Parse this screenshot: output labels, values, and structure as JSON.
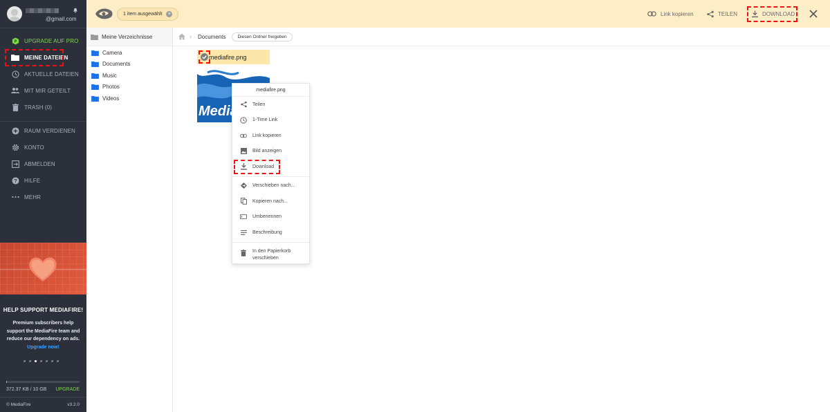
{
  "sidebar": {
    "email_suffix": "@gmail.com",
    "items": [
      {
        "label": "UPGRADE AUF PRO",
        "icon": "pro-badge-icon"
      },
      {
        "label": "MEINE DATEIEN",
        "icon": "folder-icon"
      },
      {
        "label": "AKTUELLE DATEIEN",
        "icon": "clock-icon"
      },
      {
        "label": "MIT MIR GETEILT",
        "icon": "people-icon"
      },
      {
        "label": "TRASH (0)",
        "icon": "trash-icon"
      },
      {
        "label": "RAUM VERDIENEN",
        "icon": "plus-circle-icon"
      },
      {
        "label": "KONTO",
        "icon": "gear-icon"
      },
      {
        "label": "ABMELDEN",
        "icon": "logout-icon"
      },
      {
        "label": "HILFE",
        "icon": "help-icon"
      },
      {
        "label": "MEHR",
        "icon": "more-icon"
      }
    ],
    "help_title": "HELP SUPPORT MEDIAFIRE!",
    "help_text": "Premium subscribers help support the MediaFire team and reduce our dependency on ads.",
    "help_link": "Upgrade now!",
    "storage_used": "372.37 KB / 10 GB",
    "storage_fraction": 4e-05,
    "upgrade": "UPGRADE",
    "copyright": "© MediaFire",
    "version": "v3.2.0"
  },
  "topbar": {
    "selected": "1 item ausgewählt",
    "copy_link": "Link kopieren",
    "share": "TEILEN",
    "download": "DOWNLOAD"
  },
  "tree": {
    "root": "Meine Verzeichnisse",
    "folders": [
      "Camera",
      "Documents",
      "Music",
      "Photos",
      "Videos"
    ]
  },
  "breadcrumb": {
    "current": "Documents",
    "share_folder": "Diesen Ordner freigeben"
  },
  "file": {
    "name": "mediafire.png",
    "thumb_text": "Media"
  },
  "context_menu": {
    "title": "mediafire.png",
    "items": [
      {
        "label": "Teilen",
        "icon": "share-icon"
      },
      {
        "label": "1-Time Link",
        "icon": "clock-icon"
      },
      {
        "label": "Link kopieren",
        "icon": "link-icon"
      },
      {
        "label": "Bild anzeigen",
        "icon": "image-icon"
      },
      {
        "label": "Download",
        "icon": "download-icon"
      },
      {
        "label": "Verschieben nach...",
        "icon": "move-icon"
      },
      {
        "label": "Kopieren nach...",
        "icon": "copy-icon"
      },
      {
        "label": "Umbenennen",
        "icon": "rename-icon"
      },
      {
        "label": "Beschreibung",
        "icon": "list-icon"
      },
      {
        "label": "In den Papierkorb verschieben",
        "icon": "trash-icon"
      }
    ]
  },
  "colors": {
    "sidebar_bg": "#2b303b",
    "topbar_bg": "#fdeec8",
    "accent_green": "#7fd84a",
    "folder_blue": "#1a73e8",
    "highlight_red": "#e11111"
  }
}
